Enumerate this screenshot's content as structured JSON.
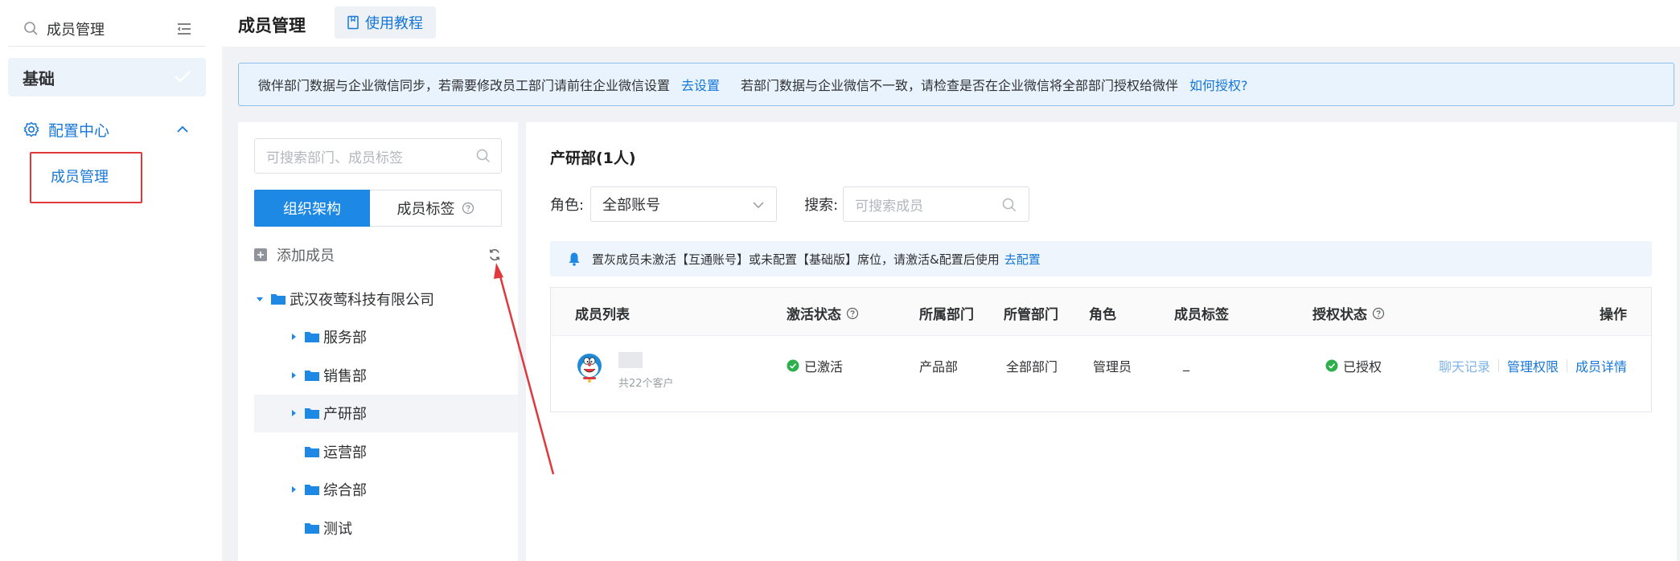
{
  "sidebar": {
    "search_value": "成员管理",
    "basic_label": "基础",
    "config_label": "配置中心",
    "members_label": "成员管理"
  },
  "topbar": {
    "title": "成员管理",
    "tutorial_label": "使用教程"
  },
  "notice": {
    "text1": "微伴部门数据与企业微信同步，若需要修改员工部门请前往企业微信设置",
    "link1": "去设置",
    "text2": "若部门数据与企业微信不一致，请检查是否在企业微信将全部部门授权给微伴",
    "link2": "如何授权?"
  },
  "tree_panel": {
    "search_placeholder": "可搜索部门、成员标签",
    "tab_org": "组织架构",
    "tab_tags": "成员标签",
    "add_member": "添加成员",
    "nodes": [
      {
        "label": "武汉夜莺科技有限公司",
        "expanded": true,
        "has_children": true,
        "selected": false
      },
      {
        "label": "服务部",
        "expanded": false,
        "has_children": true,
        "selected": false
      },
      {
        "label": "销售部",
        "expanded": false,
        "has_children": true,
        "selected": false
      },
      {
        "label": "产研部",
        "expanded": false,
        "has_children": true,
        "selected": true
      },
      {
        "label": "运营部",
        "expanded": false,
        "has_children": false,
        "selected": false
      },
      {
        "label": "综合部",
        "expanded": false,
        "has_children": true,
        "selected": false
      },
      {
        "label": "测试",
        "expanded": false,
        "has_children": false,
        "selected": false
      }
    ]
  },
  "main": {
    "dept_title": "产研部(1人)",
    "role_label": "角色:",
    "role_value": "全部账号",
    "search_label": "搜索:",
    "search_placeholder": "可搜索成员",
    "tip_text": "置灰成员未激活【互通账号】或未配置【基础版】席位，请激活&配置后使用",
    "tip_link": "去配置",
    "columns": {
      "member_list": "成员列表",
      "activation": "激活状态",
      "department": "所属部门",
      "managed_dept": "所管部门",
      "role": "角色",
      "member_tags": "成员标签",
      "auth_status": "授权状态",
      "actions": "操作"
    },
    "row": {
      "customers": "共22个客户",
      "activation": "已激活",
      "department": "产品部",
      "managed_dept": "全部部门",
      "role": "管理员",
      "tags": "_",
      "auth_status": "已授权",
      "op_chat": "聊天记录",
      "op_perm": "管理权限",
      "op_detail": "成员详情"
    }
  },
  "colors": {
    "primary": "#1677d8",
    "primary_fill": "#1e88e5",
    "success": "#2db04b",
    "highlight_red": "#e0383c"
  }
}
